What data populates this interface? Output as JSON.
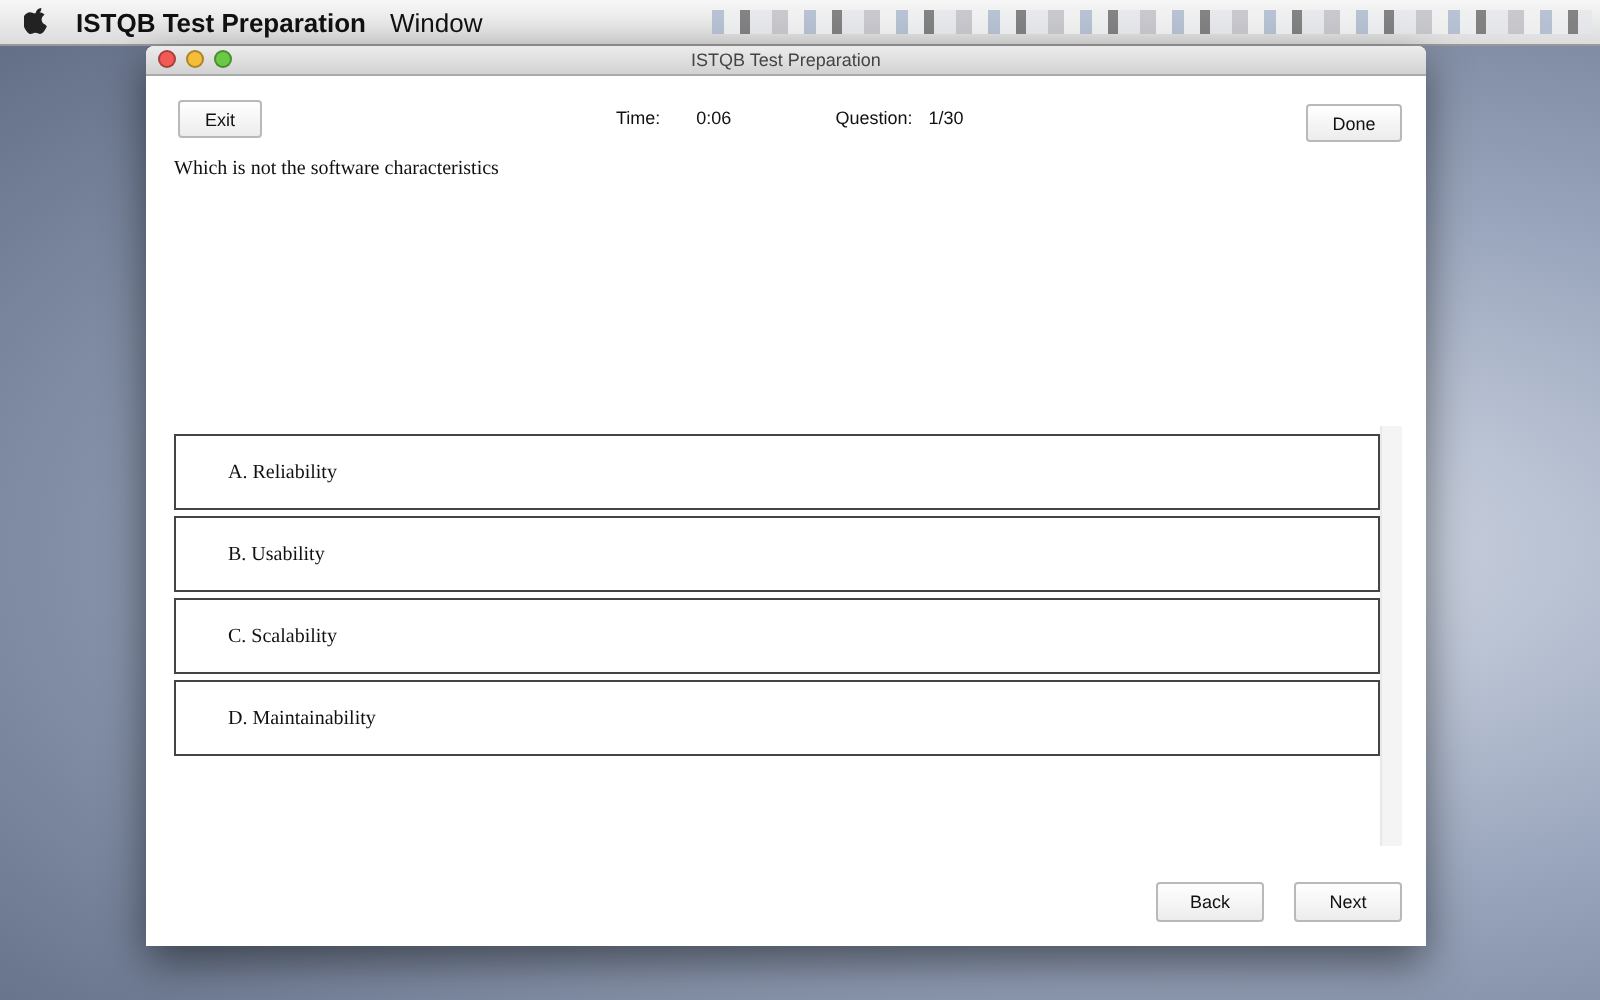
{
  "menu_bar": {
    "app_name": "ISTQB Test Preparation",
    "items": [
      "Window"
    ]
  },
  "window": {
    "title": "ISTQB Test Preparation"
  },
  "toolbar": {
    "exit_button": "Exit",
    "time_label": "Time:",
    "time_value": "0:06",
    "question_label": "Question:",
    "question_value": "1/30",
    "done_button": "Done"
  },
  "question": "Which is not the software characteristics",
  "options": [
    {
      "label": "A. Reliability"
    },
    {
      "label": "B. Usability"
    },
    {
      "label": "C. Scalability"
    },
    {
      "label": "D. Maintainability"
    }
  ],
  "buttons": [
    "Back",
    "Next"
  ]
}
